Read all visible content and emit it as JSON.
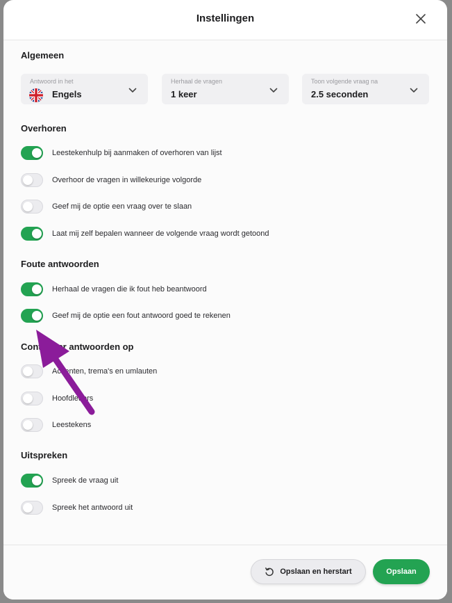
{
  "dialog": {
    "title": "Instellingen"
  },
  "sections": {
    "general": "Algemeen",
    "review": "Overhoren",
    "wrong": "Foute antwoorden",
    "check": "Controleer antwoorden op",
    "pronounce": "Uitspreken"
  },
  "selects": [
    {
      "label": "Antwoord in het",
      "value": "Engels",
      "icon": "uk-flag-icon"
    },
    {
      "label": "Herhaal de vragen",
      "value": "1 keer"
    },
    {
      "label": "Toon volgende vraag na",
      "value": "2.5 seconden"
    }
  ],
  "toggles": [
    {
      "label": "Leestekenhulp bij aanmaken of overhoren van lijst",
      "on": true
    },
    {
      "label": "Overhoor de vragen in willekeurige volgorde",
      "on": false
    },
    {
      "label": "Geef mij de optie een vraag over te slaan",
      "on": false
    },
    {
      "label": "Laat mij zelf bepalen wanneer de volgende vraag wordt getoond",
      "on": true
    },
    {
      "label": "Herhaal de vragen die ik fout heb beantwoord",
      "on": true
    },
    {
      "label": "Geef mij de optie een fout antwoord goed te rekenen",
      "on": true
    },
    {
      "label": "Accenten, trema's en umlauten",
      "on": false
    },
    {
      "label": "Hoofdletters",
      "on": false
    },
    {
      "label": "Leestekens",
      "on": false
    },
    {
      "label": "Spreek de vraag uit",
      "on": true
    },
    {
      "label": "Spreek het antwoord uit",
      "on": false
    }
  ],
  "footer": {
    "save_restart": "Opslaan en herstart",
    "save": "Opslaan"
  },
  "colors": {
    "accent": "#23a352",
    "annotation_arrow": "#8b1c9a"
  }
}
